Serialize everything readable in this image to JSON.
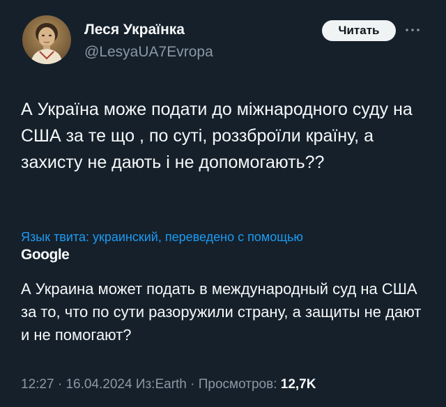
{
  "author": {
    "name": "Леся Українка",
    "handle": "@LesyaUA7Evropa",
    "avatar": "portrait-avatar"
  },
  "header": {
    "read_button_label": "Читать",
    "more_icon": "more-horizontal-icon"
  },
  "tweet": {
    "text": "А Україна може подати до міжнародного суду на США за те що , по суті, роззброїли країну, а захисту не дають і не допомогають??"
  },
  "translation": {
    "label": "Язык твита: украинский, переведено с помощью",
    "provider": "Google",
    "text": "А Украина может подать в международный суд на США за то, что по сути разоружили страну, а защиты не дают и не помогают?"
  },
  "meta": {
    "time": "12:27",
    "date": "16.04.2024",
    "source": "Из:Earth",
    "views_label": "Просмотров:",
    "views_count": "12,7K",
    "separator": "·"
  },
  "colors": {
    "background": "#15202b",
    "text": "#f7f9f9",
    "secondary": "#8b98a5",
    "link": "#1d9bf0",
    "button_bg": "#eff3f4"
  }
}
